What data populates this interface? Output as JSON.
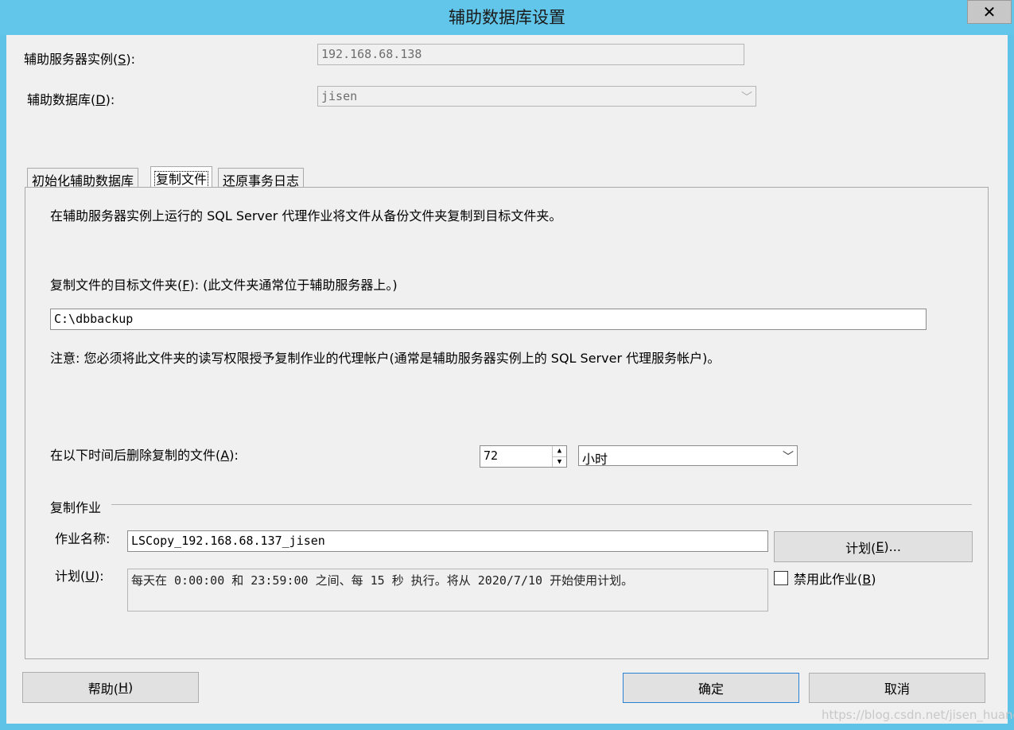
{
  "window": {
    "title": "辅助数据库设置",
    "close_glyph": "✕"
  },
  "form": {
    "server_label_pre": "辅助服务器实例(",
    "server_label_key": "S",
    "server_label_post": "):",
    "server_value": "192.168.68.138",
    "db_label_pre": "辅助数据库(",
    "db_label_key": "D",
    "db_label_post": "):",
    "db_value": "jisen"
  },
  "tabs": [
    {
      "label": "初始化辅助数据库"
    },
    {
      "label": "复制文件"
    },
    {
      "label": "还原事务日志"
    }
  ],
  "copy_tab": {
    "description": "在辅助服务器实例上运行的 SQL Server 代理作业将文件从备份文件夹复制到目标文件夹。",
    "dest_label_pre": "复制文件的目标文件夹(",
    "dest_label_key": "F",
    "dest_label_post": "): (此文件夹通常位于辅助服务器上。)",
    "dest_value": "C:\\dbbackup",
    "note": "注意: 您必须将此文件夹的读写权限授予复制作业的代理帐户(通常是辅助服务器实例上的 SQL Server 代理服务帐户)。",
    "delete_label_pre": "在以下时间后删除复制的文件(",
    "delete_label_key": "A",
    "delete_label_post": "):",
    "delete_value": "72",
    "delete_unit": "小时",
    "job_section": "复制作业",
    "job_name_label": "作业名称:",
    "job_name_value": "LSCopy_192.168.68.137_jisen",
    "schedule_btn_pre": "计划(",
    "schedule_btn_key": "E",
    "schedule_btn_post": ")...",
    "schedule_label_pre": "计划(",
    "schedule_label_key": "U",
    "schedule_label_post": "):",
    "schedule_value": "每天在 0:00:00 和 23:59:00 之间、每 15 秒 执行。将从 2020/7/10 开始使用计划。",
    "disable_label_pre": "禁用此作业(",
    "disable_label_key": "B",
    "disable_label_post": ")",
    "disable_checked": false
  },
  "footer": {
    "help_pre": "帮助(",
    "help_key": "H",
    "help_post": ")",
    "ok": "确定",
    "cancel": "取消"
  },
  "watermark": "https://blog.csdn.net/jisen_huang",
  "colors": {
    "titlebar": "#62c6ea",
    "dialog_bg": "#f0f0f0",
    "default_button_border": "#2b7fd4"
  }
}
